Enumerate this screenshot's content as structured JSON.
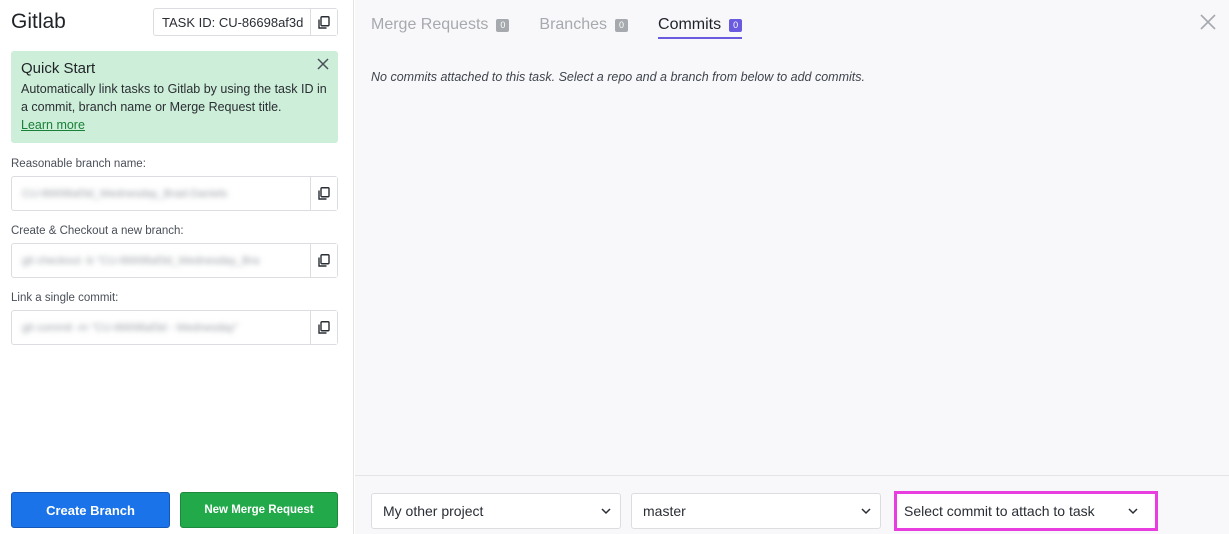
{
  "sidebar": {
    "title": "Gitlab",
    "task_id": "TASK ID: CU-86698af3d",
    "quickstart": {
      "title": "Quick Start",
      "body": "Automatically link tasks to Gitlab by using the task ID in a commit, branch name or Merge Request title.",
      "link": "Learn more"
    },
    "fields": [
      {
        "label": "Reasonable branch name:",
        "value": "CU-86698af3d_Wednesday_Brad-Daniels"
      },
      {
        "label": "Create & Checkout a new branch:",
        "value": "git checkout -b \"CU-86698af3d_Wednesday_Bra"
      },
      {
        "label": "Link a single commit:",
        "value": "git commit -m \"CU-86698af3d - Wednesday\""
      }
    ],
    "create_branch": "Create Branch",
    "new_merge_request": "New Merge Request"
  },
  "main": {
    "tabs": [
      {
        "label": "Merge Requests",
        "count": "0"
      },
      {
        "label": "Branches",
        "count": "0"
      },
      {
        "label": "Commits",
        "count": "0"
      }
    ],
    "empty_message": "No commits attached to this task. Select a repo and a branch from below to add commits.",
    "selects": {
      "project": "My other project",
      "branch": "master",
      "commit": "Select commit to attach to task"
    }
  },
  "colors": {
    "primary": "#1a73e8",
    "success": "#22a94a",
    "accent": "#6a5ae0",
    "quickstart_bg": "#cdeed8",
    "highlight": "#e83ee0"
  }
}
